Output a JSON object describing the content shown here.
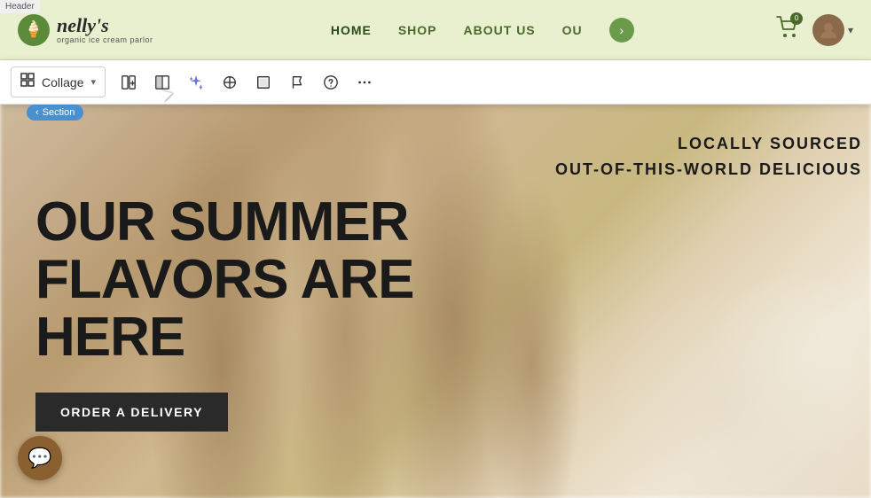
{
  "header": {
    "label": "Header",
    "logo": {
      "icon": "🍦",
      "name": "nelly's",
      "tagline": "organic ice cream parlor"
    },
    "nav": {
      "items": [
        {
          "label": "HOME",
          "active": true
        },
        {
          "label": "SHOP",
          "active": false
        },
        {
          "label": "ABOUT US",
          "active": false
        },
        {
          "label": "OU",
          "active": false
        }
      ],
      "more_icon": "›"
    },
    "cart_count": "0",
    "avatar_icon": "👤",
    "chevron_down": "▾"
  },
  "toolbar": {
    "dropdown": {
      "icon": "⊞",
      "label": "Collage",
      "chevron": "▾"
    },
    "buttons": [
      {
        "name": "add-section-btn",
        "icon": "add-section",
        "label": "Add Section"
      },
      {
        "name": "layout-btn",
        "icon": "layout",
        "label": "Layout"
      },
      {
        "name": "ai-btn",
        "icon": "sparkle",
        "label": "AI"
      },
      {
        "name": "move-btn",
        "icon": "move",
        "label": "Move"
      },
      {
        "name": "crop-btn",
        "icon": "crop",
        "label": "Crop"
      },
      {
        "name": "flag-btn",
        "icon": "flag",
        "label": "Flag"
      },
      {
        "name": "help-btn",
        "icon": "help",
        "label": "Help"
      },
      {
        "name": "more-btn",
        "icon": "more",
        "label": "More options"
      }
    ]
  },
  "section_badge": {
    "arrow": "‹",
    "label": "Section"
  },
  "hero": {
    "headline_line1": "OUR SUMMER",
    "headline_line2": "FLAVORS ARE",
    "headline_line3": "HERE",
    "subtitle_line1": "LOCALLY SOURCED",
    "subtitle_line2": "OUT-OF-THIS-WORLD DELICIOUS",
    "cta_button": "ORDER A DELIVERY"
  },
  "chat": {
    "icon": "💬"
  }
}
